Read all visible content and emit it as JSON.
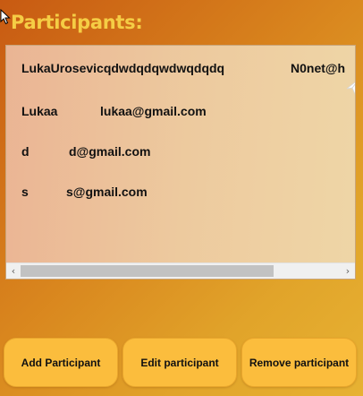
{
  "header": {
    "title": "Participants:"
  },
  "participants": [
    {
      "name": "LukaUrosevicqdwdqdqwdwqdqdq",
      "email": "N0net@h"
    },
    {
      "name": "Lukaa",
      "email": "lukaa@gmail.com"
    },
    {
      "name": "d",
      "email": "d@gmail.com"
    },
    {
      "name": "s",
      "email": "s@gmail.com"
    }
  ],
  "scrollbar": {
    "left_arrow": "‹",
    "right_arrow": "›"
  },
  "buttons": {
    "add": "Add Participant",
    "edit": "Edit participant",
    "remove": "Remove participant"
  },
  "colors": {
    "title": "#f5cd45",
    "button_bg": "#fbbd3d",
    "background_start": "#c85a12",
    "background_end": "#e7b233"
  },
  "icons": [
    "mouse-cursor-icon",
    "paper-plane-icon",
    "scroll-left-icon",
    "scroll-right-icon"
  ]
}
